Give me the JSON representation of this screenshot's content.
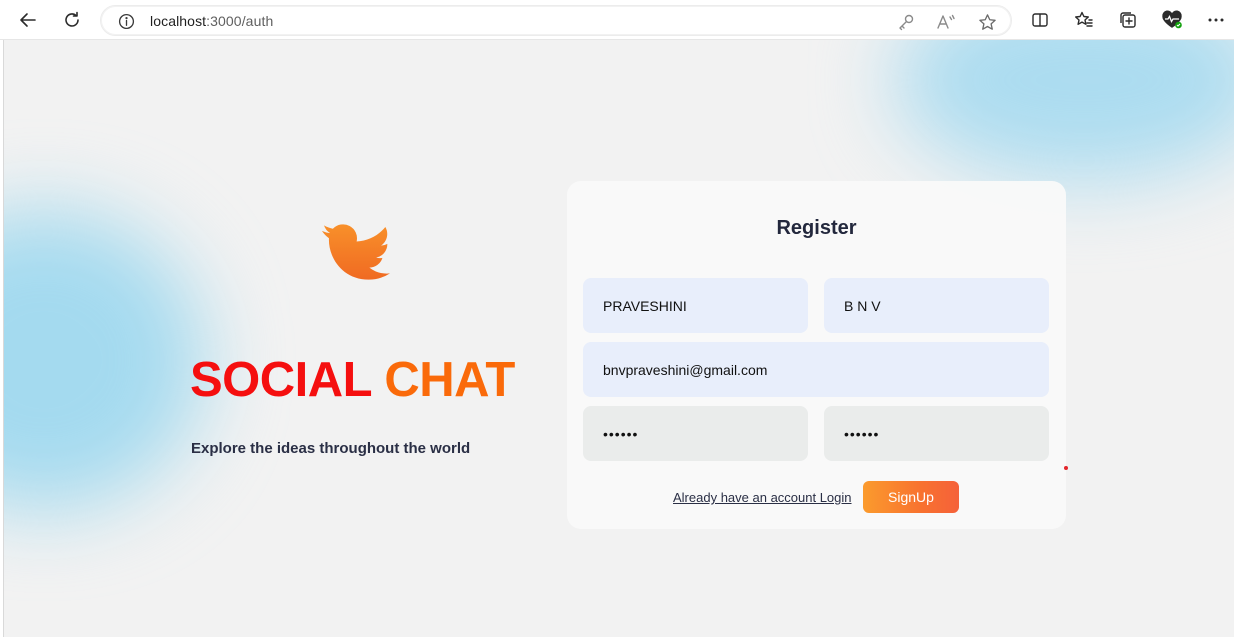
{
  "browser": {
    "url_host": "localhost",
    "url_path": ":3000/auth",
    "icons": {
      "back": "arrow-left-icon",
      "refresh": "refresh-icon",
      "info": "info-icon",
      "key": "key-icon",
      "read_aloud": "read-aloud-icon",
      "favorite": "star-icon",
      "split_screen": "split-screen-icon",
      "favorites": "favorites-list-icon",
      "collections": "collections-icon",
      "health": "browser-essentials-icon",
      "more": "more-icon"
    }
  },
  "brand": {
    "logo_icon": "bird-icon",
    "title_word1": "SOCIAL",
    "title_word2": "CHAT",
    "tagline": "Explore the ideas throughout the world",
    "colors": {
      "title_red": "#f50f0f",
      "title_orange": "#fa6a0a",
      "logo_orange": "#f57a22"
    }
  },
  "register": {
    "title": "Register",
    "first_name": "PRAVESHINI",
    "last_name": "B N V",
    "email": "bnvpraveshini@gmail.com",
    "password": "••••••",
    "confirm_password": "••••••",
    "login_link": "Already have an account Login",
    "signup_label": "SignUp",
    "signup_color": "#f8722f"
  }
}
